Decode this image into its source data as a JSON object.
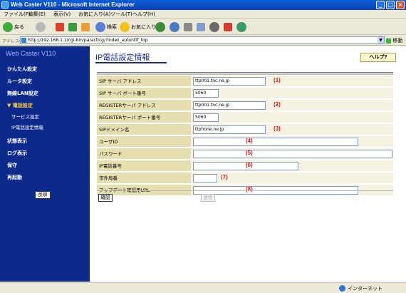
{
  "window": {
    "title": "Web Caster V110 - Microsoft Internet Explorer"
  },
  "menu": [
    "ファイル(F)",
    "編集(E)",
    "表示(V)",
    "お気に入り(A)",
    "ツール(T)",
    "ヘルプ(H)"
  ],
  "toolbar": {
    "back": "戻る",
    "search": "検索",
    "favorites": "お気に入り"
  },
  "address": {
    "label": "アドレス(D)",
    "url": "http://192.168.1.1/cgi-bin/paractlcg/?index_autonttf_top",
    "go": "移動"
  },
  "sidebar": {
    "brand": "Web Caster V110",
    "items": [
      {
        "label": "かんたん設定"
      },
      {
        "label": "ルータ設定"
      },
      {
        "label": "無線LAN設定"
      },
      {
        "label": "▼ 電話設定"
      },
      {
        "label": "状態表示"
      },
      {
        "label": "ログ表示"
      },
      {
        "label": "保守"
      },
      {
        "label": "再起動"
      }
    ],
    "subitems": [
      {
        "label": "サービス設定"
      },
      {
        "label": "IP電話設定情報"
      }
    ],
    "reflect_button": "反映"
  },
  "page": {
    "title": "IP電話設定情報",
    "help_button": "ヘルプ?",
    "confirm_button": "確認",
    "send_button": "送信"
  },
  "form": {
    "rows": [
      {
        "label": "SIP サーバ アドレス",
        "value": "ttp001.tnc.ne.jp",
        "mark": "(1)"
      },
      {
        "label": "SIP サーバ ポート番号",
        "value": "5060",
        "mark": ""
      },
      {
        "label": "REGISTERサーバ アドレス",
        "value": "ttp001.tnc.ne.jp",
        "mark": "(2)"
      },
      {
        "label": "REGISTERサーバ ポート番号",
        "value": "5060",
        "mark": ""
      },
      {
        "label": "SIPドメイン名",
        "value": "ttphone.ne.jp",
        "mark": "(3)"
      },
      {
        "label": "ユーザID",
        "value": "",
        "mark": "(4)"
      },
      {
        "label": "パスワード",
        "value": "",
        "mark": "(5)"
      },
      {
        "label": "IP電話番号",
        "value": "",
        "mark": "(6)"
      },
      {
        "label": "市外局番",
        "value": "",
        "mark": "(7)"
      },
      {
        "label": "アップデート確認用URL",
        "value": "",
        "mark": "(8)"
      }
    ]
  },
  "status": {
    "zone": "インターネット"
  }
}
